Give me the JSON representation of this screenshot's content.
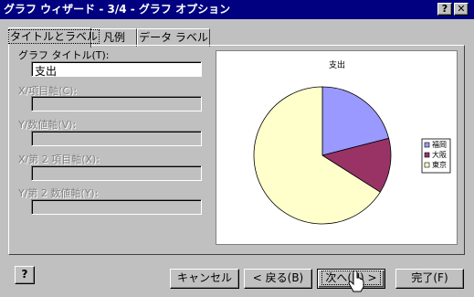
{
  "window": {
    "title": "グラフ ウィザード - 3/4 - グラフ オプション",
    "help_button": "?",
    "close_button": "✕"
  },
  "tabs": [
    {
      "label": "タイトルとラベル"
    },
    {
      "label": "凡例"
    },
    {
      "label": "データ ラベル"
    }
  ],
  "fields": {
    "chart_title_label": "グラフ タイトル(T):",
    "chart_title_value": "支出",
    "x_axis_label": "X/項目軸(C):",
    "y_axis_label": "Y/数値軸(V):",
    "x2_axis_label": "X/第 2 項目軸(X):",
    "y2_axis_label": "Y/第 2 数値軸(Y):"
  },
  "chart_data": {
    "type": "pie",
    "title": "支出",
    "categories": [
      "福岡",
      "大阪",
      "東京"
    ],
    "values": [
      21,
      13,
      66
    ],
    "colors": [
      "#9999ff",
      "#993366",
      "#ffffcc"
    ],
    "legend_position": "right"
  },
  "buttons": {
    "help_icon": "?",
    "cancel": "キャンセル",
    "back": "< 戻る(B)",
    "next": "次へ(N) >",
    "finish": "完了(F)"
  }
}
